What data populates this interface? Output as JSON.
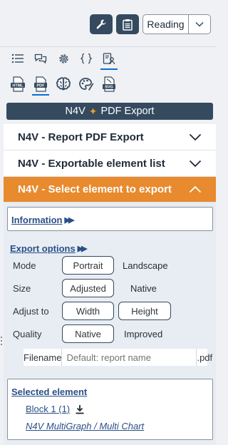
{
  "toolbar": {
    "wrench_icon": "wrench-icon",
    "clipboard_icon": "clipboard-icon",
    "reading_label": "Reading",
    "accent": "#354a5f"
  },
  "tabs_row1": [
    {
      "icon": "list-icon"
    },
    {
      "icon": "comments-icon"
    },
    {
      "icon": "gear-icon"
    },
    {
      "icon": "braces-icon"
    },
    {
      "icon": "user-document-icon",
      "active": true
    }
  ],
  "tabs_row2": [
    {
      "icon": "html-file-icon",
      "label": "HTML"
    },
    {
      "icon": "pdf-file-icon",
      "label": "PDF",
      "active": true
    },
    {
      "icon": "brain-icon"
    },
    {
      "icon": "palette-icon"
    },
    {
      "icon": "svg-file-icon",
      "label": "SVG"
    }
  ],
  "title": {
    "before": "N4V",
    "after": "PDF Export"
  },
  "panels": [
    {
      "label": "N4V - Report PDF Export",
      "expanded": false
    },
    {
      "label": "N4V - Exportable element list",
      "expanded": false
    },
    {
      "label": "N4V - Select element to export",
      "expanded": true
    }
  ],
  "information_label": "Information",
  "export_options": {
    "heading": "Export options",
    "rows": [
      {
        "label": "Mode",
        "options": [
          "Portrait",
          "Landscape"
        ],
        "selected": "Portrait"
      },
      {
        "label": "Size",
        "options": [
          "Adjusted",
          "Native"
        ],
        "selected": "Adjusted"
      },
      {
        "label": "Adjust to",
        "options": [
          "Width",
          "Height"
        ],
        "selected": "Width"
      },
      {
        "label": "Quality",
        "options": [
          "Native",
          "Improved"
        ],
        "selected": "Native"
      }
    ],
    "filename_label": "Filename",
    "filename_value": "",
    "filename_placeholder": "Default: report name",
    "filename_ext": ".pdf"
  },
  "selected": {
    "heading": "Selected element",
    "block_label": "Block 1 (1)",
    "element_type": "N4V MultiGraph / Multi Chart"
  },
  "colors": {
    "active_panel": "#e88a2e",
    "link": "#2a4f88",
    "options_bg": "#e8edf3"
  }
}
